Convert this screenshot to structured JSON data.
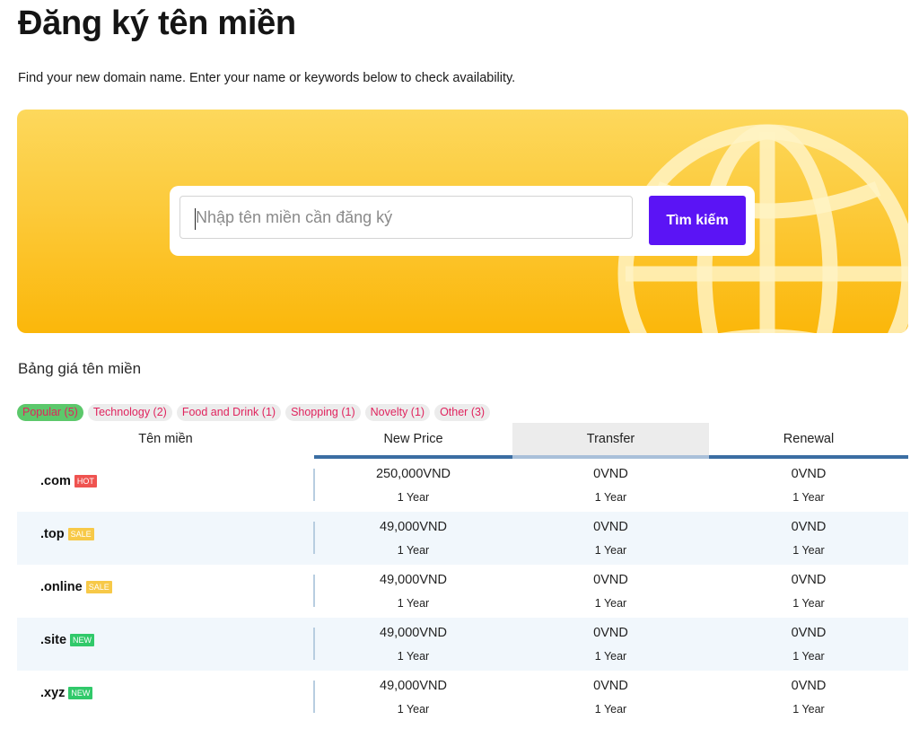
{
  "page": {
    "title": "Đăng ký tên miền",
    "subtitle": "Find your new domain name. Enter your name or keywords below to check availability."
  },
  "search": {
    "placeholder": "Nhập tên miền cần đăng ký",
    "value": "",
    "button_label": "Tìm kiếm"
  },
  "pricing": {
    "section_title": "Bảng giá tên miền",
    "filters": [
      {
        "label": "Popular (5)",
        "active": true
      },
      {
        "label": "Technology (2)",
        "active": false
      },
      {
        "label": "Food and Drink (1)",
        "active": false
      },
      {
        "label": "Shopping (1)",
        "active": false
      },
      {
        "label": "Novelty (1)",
        "active": false
      },
      {
        "label": "Other (3)",
        "active": false
      }
    ],
    "columns": [
      "Tên miền",
      "New Price",
      "Transfer",
      "Renewal"
    ],
    "rows": [
      {
        "domain": ".com",
        "badge": "HOT",
        "new_price": "250,000VND",
        "new_period": "1 Year",
        "transfer": "0VND",
        "transfer_period": "1 Year",
        "renewal": "0VND",
        "renewal_period": "1 Year"
      },
      {
        "domain": ".top",
        "badge": "SALE",
        "new_price": "49,000VND",
        "new_period": "1 Year",
        "transfer": "0VND",
        "transfer_period": "1 Year",
        "renewal": "0VND",
        "renewal_period": "1 Year"
      },
      {
        "domain": ".online",
        "badge": "SALE",
        "new_price": "49,000VND",
        "new_period": "1 Year",
        "transfer": "0VND",
        "transfer_period": "1 Year",
        "renewal": "0VND",
        "renewal_period": "1 Year"
      },
      {
        "domain": ".site",
        "badge": "NEW",
        "new_price": "49,000VND",
        "new_period": "1 Year",
        "transfer": "0VND",
        "transfer_period": "1 Year",
        "renewal": "0VND",
        "renewal_period": "1 Year"
      },
      {
        "domain": ".xyz",
        "badge": "NEW",
        "new_price": "49,000VND",
        "new_period": "1 Year",
        "transfer": "0VND",
        "transfer_period": "1 Year",
        "renewal": "0VND",
        "renewal_period": "1 Year"
      }
    ]
  },
  "icons": {
    "hero_decoration": "globe-icon"
  },
  "colors": {
    "hero_top": "#fdd85c",
    "hero_bottom": "#fbb70a",
    "search_button": "#5b14f5",
    "active_filter": "#5cc86b",
    "filter_text": "#e0245e",
    "header_accent": "#3b6ea3",
    "badge_hot": "#ef5350",
    "badge_sale": "#f7c948",
    "badge_new": "#31c96a",
    "row_alt": "#f1f7fc"
  }
}
